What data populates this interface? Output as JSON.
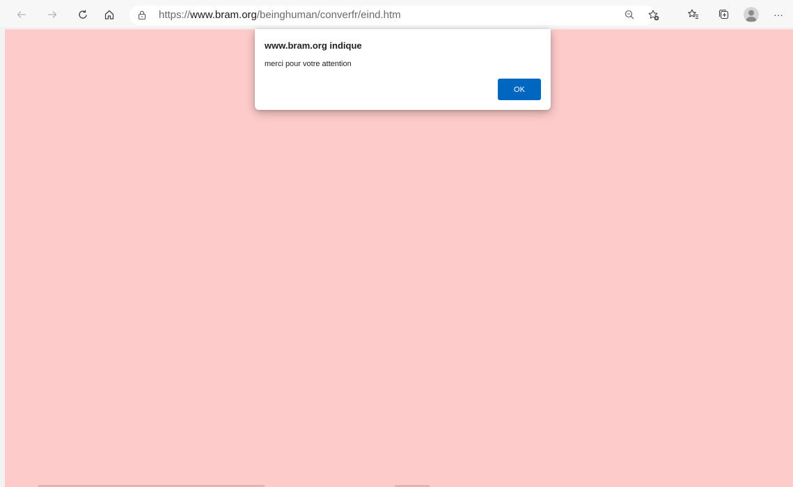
{
  "browser": {
    "url": {
      "scheme": "https://",
      "host": "www.bram.org",
      "path": "/beinghuman/converfr/eind.htm"
    },
    "toolbar_icons": [
      "back-icon",
      "forward-icon",
      "refresh-icon",
      "home-icon",
      "lock-icon",
      "zoom-out-icon",
      "add-favorite-icon",
      "favorites-icon",
      "collections-icon",
      "profile-icon",
      "more-icon"
    ],
    "more_label": "···"
  },
  "page": {
    "background": "#fdcbca"
  },
  "dialog": {
    "title": "www.bram.org indique",
    "message": "merci pour votre attention",
    "ok_label": "OK",
    "accent": "#0067c0"
  }
}
